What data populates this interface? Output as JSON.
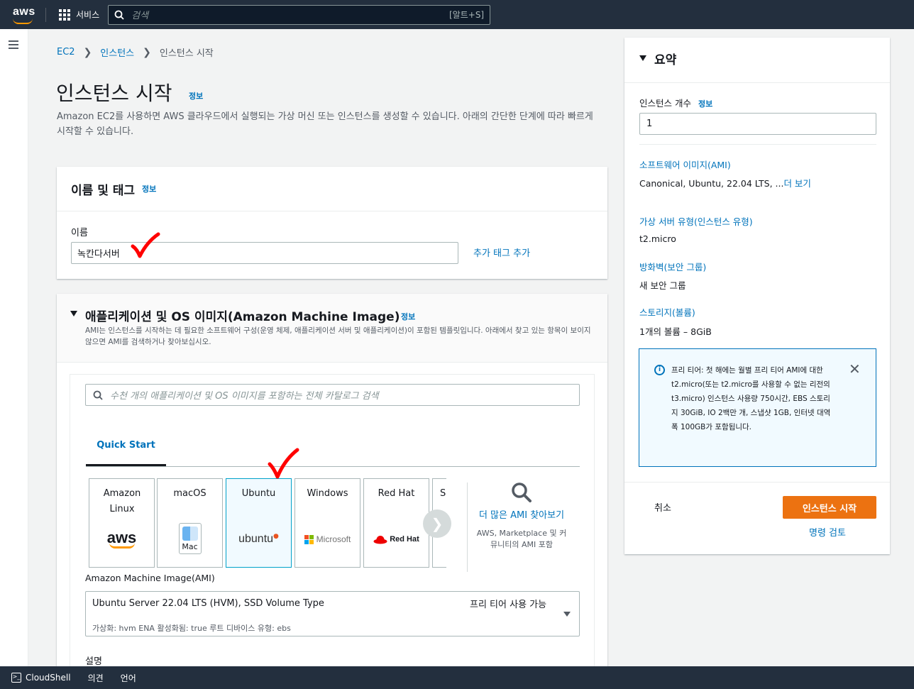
{
  "topbar": {
    "logo_text": "aws",
    "services_label": "서비스",
    "search_placeholder": "검색",
    "search_shortcut": "[알트+S]"
  },
  "breadcrumb": [
    "EC2",
    "인스턴스",
    "인스턴스 시작"
  ],
  "page": {
    "title": "인스턴스 시작",
    "info": "정보",
    "description": "Amazon EC2를 사용하면 AWS 클라우드에서 실행되는 가상 머신 또는 인스턴스를 생성할 수 있습니다. 아래의 간단한 단계에 따라 빠르게 시작할 수 있습니다."
  },
  "name_tags": {
    "title": "이름 및 태그",
    "info": "정보",
    "name_label": "이름",
    "name_value": "녹칸다서버",
    "add_tag": "추가 태그 추가"
  },
  "ami_section": {
    "title": "애플리케이션 및 OS 이미지(Amazon Machine Image)",
    "info": "정보",
    "description": "AMI는 인스턴스를 시작하는 데 필요한 소프트웨어 구성(운영 체제, 애플리케이션 서버 및 애플리케이션)이 포함된 템플릿입니다. 아래에서 찾고 있는 항목이 보이지 않으면 AMI를 검색하거나 찾아보십시오.",
    "search_placeholder": "수천 개의 애플리케이션 및 OS 이미지를 포함하는 전체 카탈로그 검색",
    "tab": "Quick Start",
    "tiles": [
      {
        "name": "Amazon Linux",
        "logo": "aws"
      },
      {
        "name": "macOS",
        "logo": "Mac"
      },
      {
        "name": "Ubuntu",
        "logo": "ubuntu"
      },
      {
        "name": "Windows",
        "logo": "Microsoft"
      },
      {
        "name": "Red Hat",
        "logo": "Red Hat"
      },
      {
        "name": "S",
        "logo": ""
      }
    ],
    "more_label": "더 많은 AMI 찾아보기",
    "more_sub": "AWS, Marketplace 및 커뮤니티의 AMI 포함",
    "ami_label": "Amazon Machine Image(AMI)",
    "ami_value": "Ubuntu Server 22.04 LTS (HVM), SSD Volume Type",
    "ami_free": "프리 티어 사용 가능",
    "ami_meta": "가상화: hvm    ENA 활성화됨: true    루트 디바이스 유형: ebs",
    "desc_label": "설명"
  },
  "summary": {
    "title": "요약",
    "count_label": "인스턴스 개수",
    "count_info": "정보",
    "count_value": "1",
    "software_label": "소프트웨어 이미지(AMI)",
    "software_value": "Canonical, Ubuntu, 22.04 LTS, ...",
    "software_more": "더 보기",
    "type_label": "가상 서버 유형(인스턴스 유형)",
    "type_value": "t2.micro",
    "firewall_label": "방화벽(보안 그룹)",
    "firewall_value": "새 보안 그룹",
    "storage_label": "스토리지(볼륨)",
    "storage_value": "1개의 볼륨 – 8GiB",
    "free_tier_text": "프리 티어: 첫 해에는 월별 프리 티어 AMI에 대한 t2.micro(또는 t2.micro를 사용할 수 없는 리전의 t3.micro) 인스턴스 사용량 750시간, EBS 스토리지 30GiB, IO 2백만 개, 스냅샷 1GB, 인터넷 대역폭 100GB가 포함됩니다.",
    "cancel": "취소",
    "launch": "인스턴스 시작",
    "review": "명령 검토"
  },
  "bottombar": {
    "cloudshell": "CloudShell",
    "feedback": "의견",
    "language": "언어"
  },
  "colors": {
    "nav_bg": "#232f3e",
    "link": "#0073bb",
    "primary_button": "#ec7211",
    "annotation_check": "#ff0000"
  }
}
